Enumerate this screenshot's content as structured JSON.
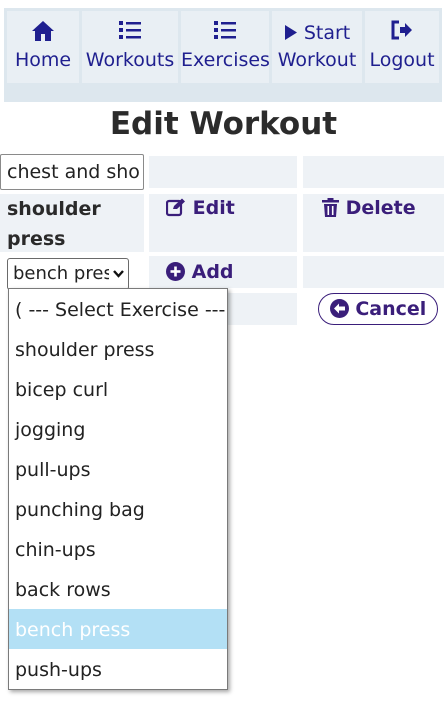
{
  "nav": {
    "home": "Home",
    "workouts": "Workouts",
    "exercises": "Exercises",
    "start_workout": "Start",
    "start_workout_line2": "Workout",
    "logout": "Logout"
  },
  "page_title": "Edit Workout",
  "workout_name_value": "chest and sho",
  "exercise_row": {
    "name_line1": "shoulder",
    "name_line2": "press",
    "edit_label": "Edit",
    "delete_label": "Delete"
  },
  "add_row": {
    "selected_value": "bench press",
    "add_label": "Add"
  },
  "cancel_label": "Cancel",
  "dropdown_options": [
    "( --- Select Exercise --- )",
    "shoulder press",
    "bicep curl",
    "jogging",
    "pull-ups",
    "punching bag",
    "chin-ups",
    "back rows",
    "bench press",
    "push-ups"
  ],
  "colors": {
    "nav_text": "#1f1f8f",
    "action_purple": "#3a1e7a",
    "cell_bg": "#eef2f6",
    "selected_option_bg": "#b3e0f5"
  }
}
